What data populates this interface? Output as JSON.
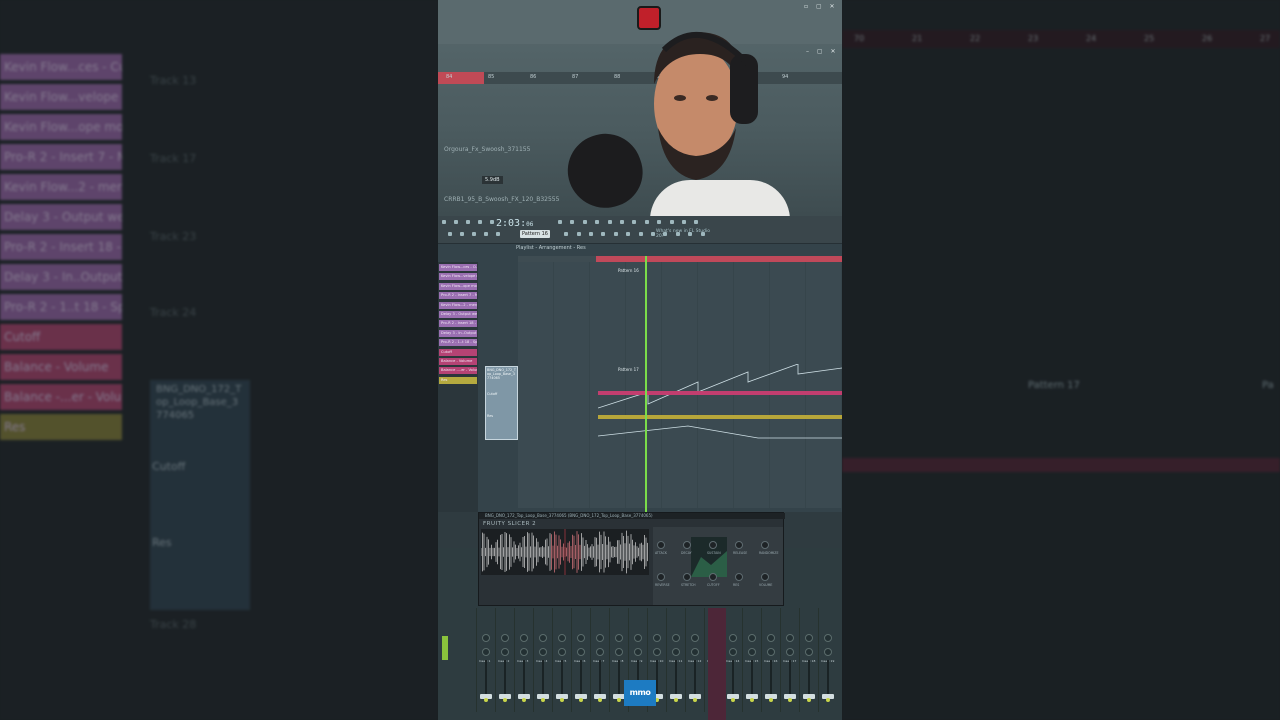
{
  "left_panel": {
    "channels": [
      {
        "label": "Kevin Flow...ces - Cutoff",
        "color": "#8c5d9c"
      },
      {
        "label": "Kevin Flow...velope mod",
        "color": "#8c5d9c"
      },
      {
        "label": "Kevin Flow...ope mod #2",
        "color": "#8c5d9c"
      },
      {
        "label": "Pro-R 2 - Insert 7 - Mix",
        "color": "#8c5d9c"
      },
      {
        "label": "Kevin Flow...2 - merged",
        "color": "#8c5d9c"
      },
      {
        "label": "Delay 3 - Output wet",
        "color": "#8c5d9c"
      },
      {
        "label": "Pro-R 2 - Insert 18 - Mix",
        "color": "#8c5d9c"
      },
      {
        "label": "Delay 3 - In..Output wet",
        "color": "#8c5d9c"
      },
      {
        "label": "Pro-R 2 - 1..t 18 - Space",
        "color": "#8c5d9c"
      },
      {
        "label": "Cutoff",
        "color": "#a03d66"
      },
      {
        "label": "Balance - Volume",
        "color": "#a03d66"
      },
      {
        "label": "Balance -...er - Volume",
        "color": "#a03d66"
      },
      {
        "label": "Res",
        "color": "#7a7434"
      }
    ],
    "tracks": [
      "Track 13",
      "Track 17",
      "Track 23",
      "Track 24",
      "Track 28"
    ],
    "selected_clip": "BNG_DNO_172_T op_Loop_Base_3 774065",
    "lanes": [
      "Cutoff",
      "Res"
    ]
  },
  "right_panel": {
    "ruler_numbers": [
      "70",
      "21",
      "22",
      "23",
      "24",
      "25",
      "26",
      "27"
    ],
    "pattern_label": "Pattern 17",
    "pattern_label_2": "Pa"
  },
  "webcam": {
    "clip_1": "Orgoura_Fx_Swoosh_371155",
    "clip_2": "CRRB1_95_B_Swoosh_FX_120_B32555",
    "volume_tag": "5.9dB",
    "ruler": [
      "84",
      "85",
      "86",
      "87",
      "88",
      "89",
      "92",
      "93",
      "94"
    ]
  },
  "toolbar": {
    "time": "2:03:",
    "time_small": "06",
    "pattern": "Pattern 16",
    "hint": "What's new in FL Studio 20?"
  },
  "playlist": {
    "title": "Playlist - Arrangement - Res",
    "pattern_17": "Pattern 17",
    "pattern_16": "Pattern 16",
    "lane_cutoff": "Cutoff",
    "lane_res": "Res",
    "picker": [
      {
        "label": "Kevin Flow...ces - Cutoff",
        "color": "#9a6fb1"
      },
      {
        "label": "Kevin Flow...velope mod",
        "color": "#9a6fb1"
      },
      {
        "label": "Kevin Flow...ope mod #2",
        "color": "#9a6fb1"
      },
      {
        "label": "Pro-R 2 - Insert 7 - Mix",
        "color": "#9a6fb1"
      },
      {
        "label": "Kevin Flow...2 - merged",
        "color": "#9a6fb1"
      },
      {
        "label": "Delay 3 - Output wet",
        "color": "#9a6fb1"
      },
      {
        "label": "Pro-R 2 - Insert 18 - Mix",
        "color": "#9a6fb1"
      },
      {
        "label": "Delay 3 - In..Output wet",
        "color": "#9a6fb1"
      },
      {
        "label": "Pro-R 2 - 1..t 18 - Space",
        "color": "#9a6fb1"
      },
      {
        "label": "Cutoff",
        "color": "#b54374"
      },
      {
        "label": "Balance - Volume",
        "color": "#b54374"
      },
      {
        "label": "Balance -...er - Volume",
        "color": "#b54374"
      },
      {
        "label": "Res",
        "color": "#b5aa3f"
      }
    ],
    "selected": "BNG_DNO_172_T op_Loop_Base_3 774065"
  },
  "slicer": {
    "header": "BNG_DNO_172_Top_Loop_Base_3774065 (BNG_DNO_172_Top_Loop_Base_3774065)",
    "name": "FRUITY SLICER 2",
    "knobs": [
      "ATTACK",
      "DECAY",
      "SUSTAIN",
      "RELEASE",
      "RANDOMIZE",
      "REVERSE",
      "STRETCH",
      "CUTOFF",
      "RES",
      "VOLUME"
    ]
  },
  "mixer": {
    "strips": [
      "Insert 1",
      "Insert 2",
      "Insert 3",
      "Insert 4",
      "Insert 5",
      "Insert 6",
      "Insert 7",
      "Insert 8",
      "Insert 9",
      "Insert 10",
      "Insert 11",
      "Insert 12",
      "Insert 13",
      "Insert 14",
      "Insert 15",
      "Insert 16",
      "Insert 17",
      "Insert 18",
      "Insert 19"
    ]
  },
  "logo": "mmo"
}
